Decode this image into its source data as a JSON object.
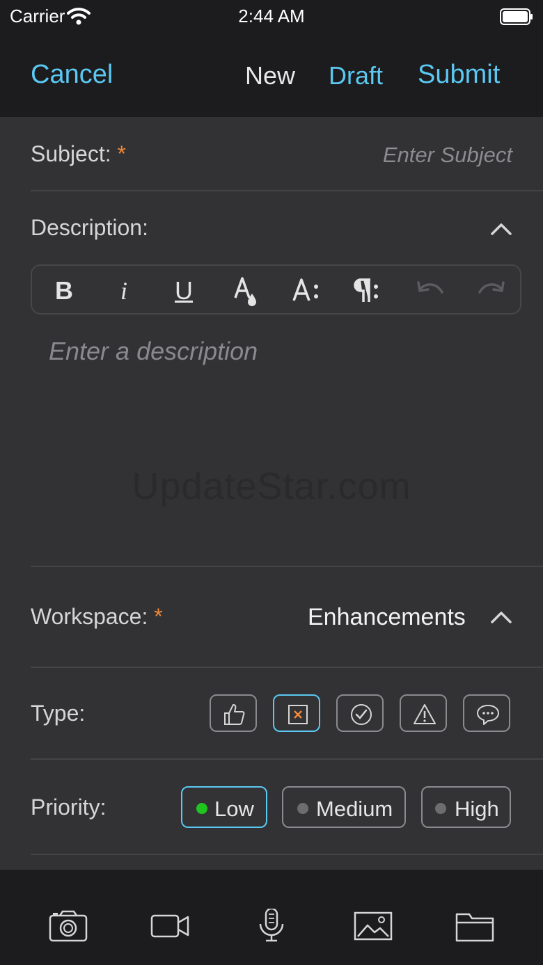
{
  "status": {
    "carrier": "Carrier",
    "time": "2:44 AM"
  },
  "nav": {
    "cancel": "Cancel",
    "new": "New",
    "draft": "Draft",
    "submit": "Submit"
  },
  "subject": {
    "label": "Subject:",
    "required": "*",
    "placeholder": "Enter Subject"
  },
  "description": {
    "label": "Description:",
    "placeholder": "Enter a description",
    "toolbar": [
      "bold-icon",
      "italic-icon",
      "underline-icon",
      "text-color-icon",
      "font-size-icon",
      "paragraph-icon",
      "undo-icon",
      "redo-icon"
    ]
  },
  "watermark": "UpdateStar.com",
  "workspace": {
    "label": "Workspace:",
    "required": "*",
    "value": "Enhancements"
  },
  "type": {
    "label": "Type:",
    "options": [
      "thumbs-up-icon",
      "close-box-icon",
      "check-circle-icon",
      "warning-icon",
      "comment-icon"
    ],
    "selected": "close-box-icon"
  },
  "priority": {
    "label": "Priority:",
    "options": [
      "Low",
      "Medium",
      "High"
    ],
    "selected": "Low"
  },
  "bottom_bar": [
    "camera-icon",
    "video-icon",
    "microphone-icon",
    "image-icon",
    "folder-icon"
  ],
  "colors": {
    "accent": "#5bc8f2",
    "required": "#f0883a",
    "selected_dot": "#1fc51f",
    "background": "#323234",
    "bar": "#1c1c1e"
  }
}
